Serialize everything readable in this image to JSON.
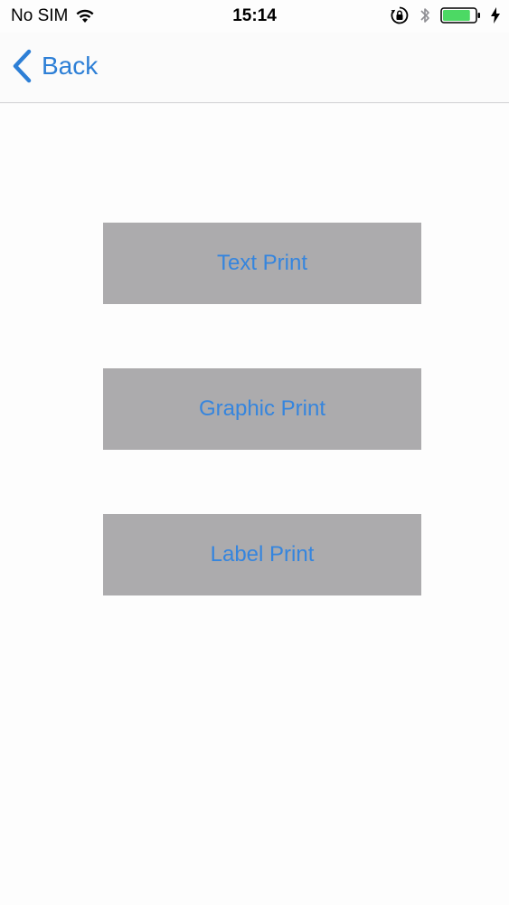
{
  "status_bar": {
    "carrier": "No SIM",
    "time": "15:14",
    "icons": {
      "wifi": "wifi-icon",
      "orientation_lock": "orientation-lock-icon",
      "bluetooth": "bluetooth-icon",
      "battery": "battery-icon",
      "charging": "charging-bolt-icon"
    },
    "battery_level": 0.85
  },
  "nav": {
    "back_label": "Back"
  },
  "buttons": {
    "text_print": "Text Print",
    "graphic_print": "Graphic Print",
    "label_print": "Label Print"
  },
  "colors": {
    "accent": "#2d7fd6",
    "button_bg": "#acabad",
    "button_text": "#3585de",
    "battery_fill": "#4cd964"
  }
}
